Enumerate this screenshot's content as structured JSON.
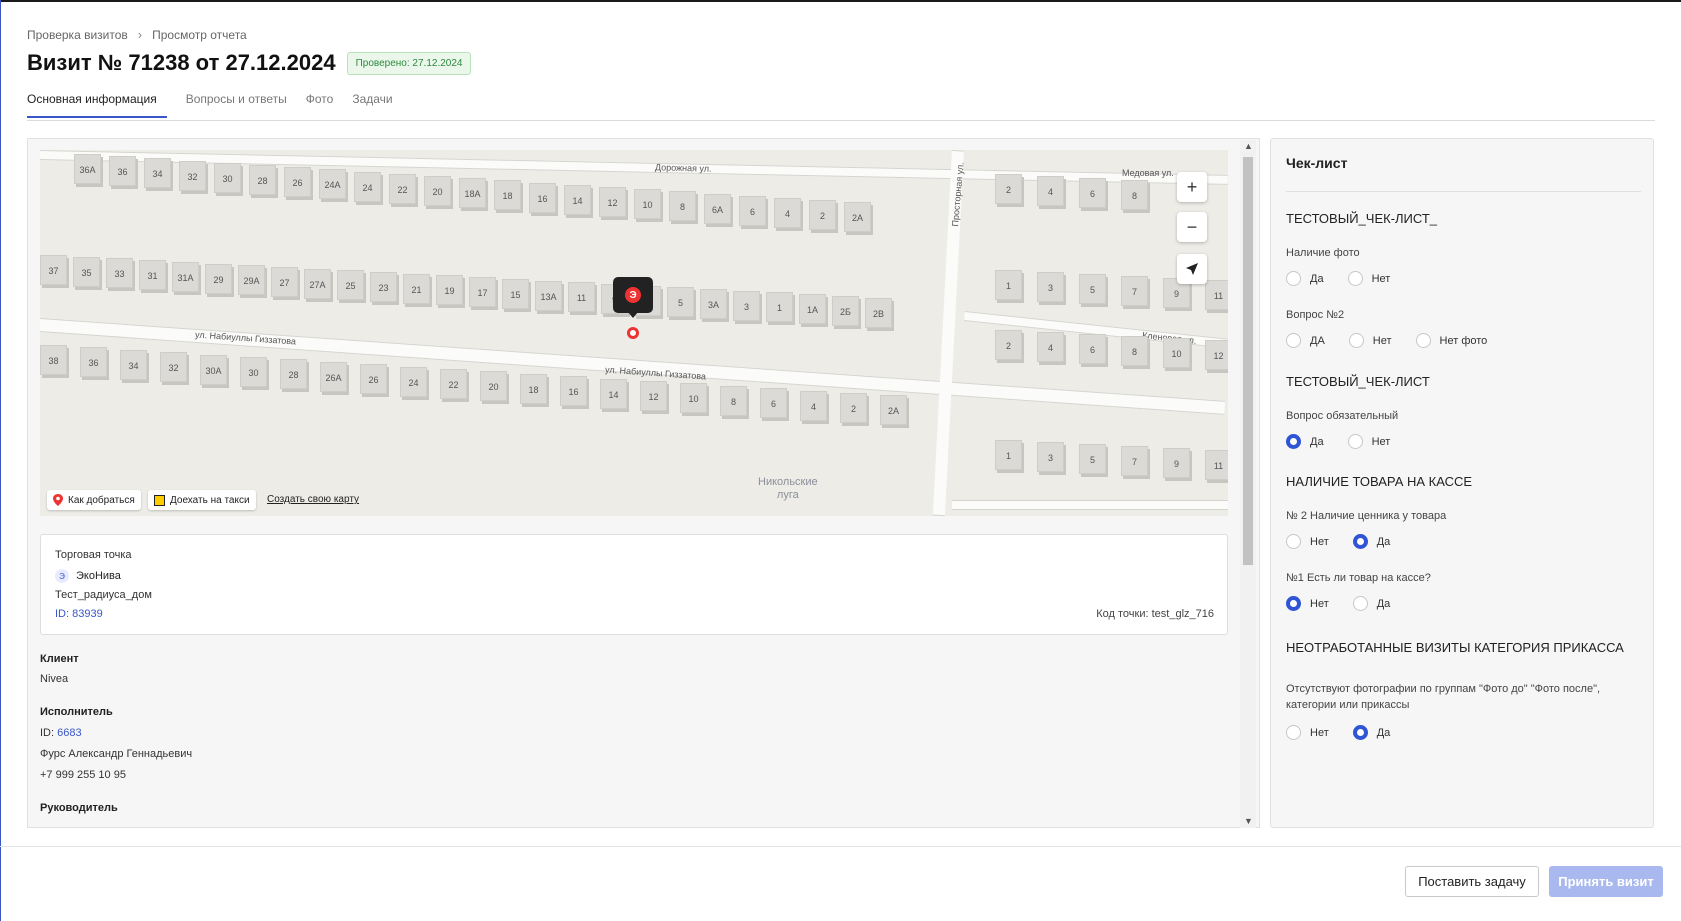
{
  "breadcrumb": {
    "items": [
      "Проверка визитов",
      "Просмотр отчета"
    ]
  },
  "page": {
    "title": "Визит № 71238 от 27.12.2024",
    "status_badge": "Проверено: 27.12.2024"
  },
  "tabs": [
    {
      "label": "Основная информация",
      "active": true
    },
    {
      "label": "Вопросы и ответы",
      "active": false
    },
    {
      "label": "Фото",
      "active": false
    },
    {
      "label": "Задачи",
      "active": false
    }
  ],
  "map": {
    "streets": [
      "Дорожная ул.",
      "Медовая ул.",
      "Просторная ул.",
      "ул. Набиуллы Гиззатова",
      "ул. Набиуллы Гиззатова",
      "Кленовая ул."
    ],
    "area_label": [
      "Никольские",
      "луга"
    ],
    "house_numbers_row1": [
      "36А",
      "36",
      "34",
      "32",
      "30",
      "28",
      "26",
      "24А",
      "24",
      "22",
      "20",
      "18А",
      "18",
      "16",
      "14",
      "12",
      "10",
      "8",
      "6А",
      "6",
      "4",
      "2",
      "2А"
    ],
    "house_numbers_row2": [
      "37",
      "35",
      "33",
      "31",
      "31А",
      "29",
      "29А",
      "27",
      "27А",
      "25",
      "23",
      "21",
      "19",
      "17",
      "15",
      "13А",
      "11",
      "9",
      "7",
      "5",
      "3А",
      "3",
      "1",
      "1А",
      "2Б",
      "2В"
    ],
    "house_numbers_row3": [
      "38",
      "36",
      "34",
      "32",
      "30А",
      "30",
      "28",
      "26А",
      "26",
      "24",
      "22",
      "20",
      "18",
      "16",
      "14",
      "12",
      "10",
      "8",
      "6",
      "4",
      "2",
      "2А"
    ],
    "house_numbers_right": [
      "2",
      "4",
      "6",
      "8",
      "1",
      "3",
      "5",
      "7",
      "9",
      "11",
      "2",
      "4",
      "6",
      "8",
      "10",
      "12",
      "1",
      "3",
      "5",
      "7",
      "9",
      "11"
    ],
    "pin_letter": "Э",
    "zoom_in": "+",
    "zoom_out": "−",
    "locate_icon": "navigation-arrow-icon",
    "route_label": "Как добраться",
    "taxi_label": "Доехать на такси",
    "create_map_link": "Создать свою карту"
  },
  "shop": {
    "label": "Торговая точка",
    "chain_icon_letter": "Э",
    "chain_name": "ЭкоНива",
    "address": "Тест_радиуса_дом",
    "id_label": "ID: 83939",
    "code_label": "Код точки:",
    "code_value": "test_glz_716"
  },
  "client": {
    "label": "Клиент",
    "value": "Nivea"
  },
  "executor": {
    "label": "Исполнитель",
    "id_prefix": "ID:",
    "id_value": "6683",
    "name": "Фурс Александр Геннадьевич",
    "phone": "+7 999 255 10 95"
  },
  "manager": {
    "label": "Руководитель"
  },
  "checklist": {
    "title": "Чек-лист",
    "sections": [
      {
        "title": "ТЕСТОВЫЙ_ЧЕК-ЛИСТ_",
        "questions": [
          {
            "text": "Наличие фото",
            "options": [
              {
                "label": "Да",
                "checked": false
              },
              {
                "label": "Нет",
                "checked": false
              }
            ]
          },
          {
            "text": "Вопрос №2",
            "options": [
              {
                "label": "ДА",
                "checked": false
              },
              {
                "label": "Нет",
                "checked": false
              },
              {
                "label": "Нет фото",
                "checked": false
              }
            ]
          }
        ]
      },
      {
        "title": "ТЕСТОВЫЙ_ЧЕК-ЛИСТ",
        "questions": [
          {
            "text": "Вопрос обязательный",
            "options": [
              {
                "label": "Да",
                "checked": true
              },
              {
                "label": "Нет",
                "checked": false
              }
            ]
          }
        ]
      },
      {
        "title": "НАЛИЧИЕ ТОВАРА НА КАССЕ",
        "questions": [
          {
            "text": "№ 2 Наличие ценника у товара",
            "options": [
              {
                "label": "Нет",
                "checked": false
              },
              {
                "label": "Да",
                "checked": true
              }
            ]
          },
          {
            "text": "№1 Есть ли товар на кассе?",
            "options": [
              {
                "label": "Нет",
                "checked": true
              },
              {
                "label": "Да",
                "checked": false
              }
            ]
          }
        ]
      },
      {
        "title": "НЕОТРАБОТАННЫЕ ВИЗИТЫ КАТЕГОРИЯ ПРИКАССА",
        "questions": [
          {
            "text": "Отсутствуют фотографии по группам \"Фото до\" \"Фото после\", категории или прикассы",
            "options": [
              {
                "label": "Нет",
                "checked": false
              },
              {
                "label": "Да",
                "checked": true
              }
            ]
          }
        ]
      }
    ]
  },
  "footer": {
    "set_task": "Поставить задачу",
    "accept_visit": "Принять визит"
  },
  "colors": {
    "accent": "#2f55d4",
    "badge_green": "#2e8a3e",
    "primary_disabled": "#a9b8ee",
    "pin_red": "#e33333"
  }
}
